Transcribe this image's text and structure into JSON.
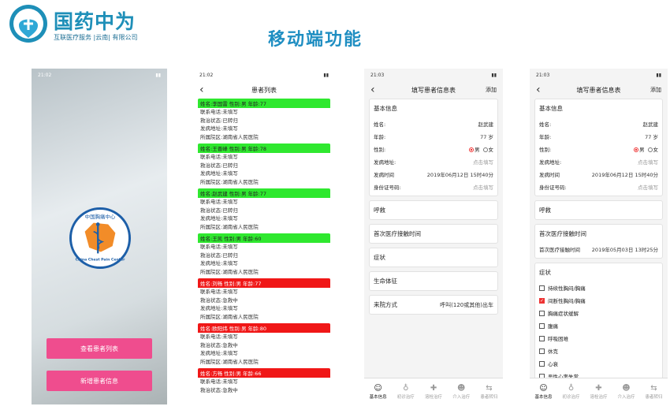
{
  "brand": {
    "name": "国药中为",
    "tagline": "互联医疗服务 |云南| 有限公司"
  },
  "headline": "移动端功能",
  "colors": {
    "brand_blue": "#1f8ec2",
    "pink": "#ef4d8e",
    "green_header": "#2fe82f",
    "red_header": "#f01717"
  },
  "splash": {
    "time": "21:02",
    "logo_text": "中国胸痛中心",
    "logo_text_en": "China Chest Pain Center",
    "btn_list": "查看患者列表",
    "btn_add": "新增患者信息"
  },
  "list": {
    "time": "21:02",
    "title": "患者列表",
    "patients": [
      {
        "header": "姓名:李国雷 性别:男 年龄:77",
        "status": "green",
        "phone": "联系电话:未填写",
        "rescue": "救治状态:已转归",
        "addr": "发病地址:未填写",
        "hospital": "所属院区:湖南省人民医院"
      },
      {
        "header": "姓名:王晋峰 性别:男 年龄:78",
        "status": "green",
        "phone": "联系电话:未填写",
        "rescue": "救治状态:已转归",
        "addr": "发病地址:未填写",
        "hospital": "所属院区:湖南省人民医院"
      },
      {
        "header": "姓名:赵武建 性别:男 年龄:77",
        "status": "green",
        "phone": "联系电话:未填写",
        "rescue": "救治状态:已转归",
        "addr": "发病地址:未填写",
        "hospital": "所属院区:湖南省人民医院"
      },
      {
        "header": "姓名:王凯 性别:男 年龄:60",
        "status": "green",
        "phone": "联系电话:未填写",
        "rescue": "救治状态:已转归",
        "addr": "发病地址:未填写",
        "hospital": "所属院区:湖南省人民医院"
      },
      {
        "header": "姓名:刘畅 性别:男 年龄:77",
        "status": "red",
        "phone": "联系电话:未填写",
        "rescue": "救治状态:急救中",
        "addr": "发病地址:未填写",
        "hospital": "所属院区:湖南省人民医院"
      },
      {
        "header": "姓名:欧阳炜 性别:男 年龄:80",
        "status": "red",
        "phone": "联系电话:未填写",
        "rescue": "救治状态:急救中",
        "addr": "发病地址:未填写",
        "hospital": "所属院区:湖南省人民医院"
      },
      {
        "header": "姓名:方畅 性别:男 年龄:66",
        "status": "red",
        "phone": "联系电话:未填写",
        "rescue": "救治状态:急救中",
        "addr": "",
        "hospital": ""
      }
    ]
  },
  "form1": {
    "time": "21:03",
    "title": "填写患者信息表",
    "add": "添加",
    "basic": "基本信息",
    "name_label": "姓名:",
    "name_value": "赵武建",
    "age_label": "年龄:",
    "age_value": "77 岁",
    "sex_label": "性别:",
    "male": "男",
    "female": "女",
    "addr_label": "发病地址:",
    "addr_hint": "点击填写",
    "time_label": "发病时间",
    "time_value": "2019年06月12日 15时40分",
    "id_label": "身份证号码:",
    "id_hint": "点击填写",
    "sections": [
      "呼救",
      "首次医疗接触时间",
      "症状",
      "生命体征"
    ],
    "arrival_label": "来院方式",
    "arrival_value": "呼叫(120或其他)出车"
  },
  "form2": {
    "time": "21:03",
    "title": "填写患者信息表",
    "add": "添加",
    "basic": "基本信息",
    "name_label": "姓名:",
    "name_value": "赵武建",
    "age_label": "年龄:",
    "age_value": "77 岁",
    "sex_label": "性别:",
    "male": "男",
    "female": "女",
    "addr_label": "发病地址:",
    "addr_hint": "点击填写",
    "time_label": "发病时间",
    "time_value": "2019年06月12日 15时40分",
    "id_label": "身份证号码:",
    "id_hint": "点击填写",
    "call": "呼救",
    "fmc": "首次医疗接触时间",
    "fmc_label": "首次医疗接触时间",
    "fmc_value": "2019年05月03日 13时25分",
    "symptom": "症状",
    "symptoms": [
      {
        "label": "持续性胸闷/胸痛",
        "checked": false
      },
      {
        "label": "间断性胸闷/胸痛",
        "checked": true
      },
      {
        "label": "胸痛症状缓解",
        "checked": false
      },
      {
        "label": "腹痛",
        "checked": false
      },
      {
        "label": "呼吸困难",
        "checked": false
      },
      {
        "label": "休克",
        "checked": false
      },
      {
        "label": "心衰",
        "checked": false
      },
      {
        "label": "恶性心率失常",
        "checked": false
      }
    ]
  },
  "tabs": [
    {
      "label": "基本信息",
      "icon": "person-icon"
    },
    {
      "label": "初诊治疗",
      "icon": "stethoscope-icon"
    },
    {
      "label": "溶栓治疗",
      "icon": "kit-icon"
    },
    {
      "label": "介入治疗",
      "icon": "doctor-icon"
    },
    {
      "label": "患者转归",
      "icon": "transfer-icon"
    }
  ]
}
